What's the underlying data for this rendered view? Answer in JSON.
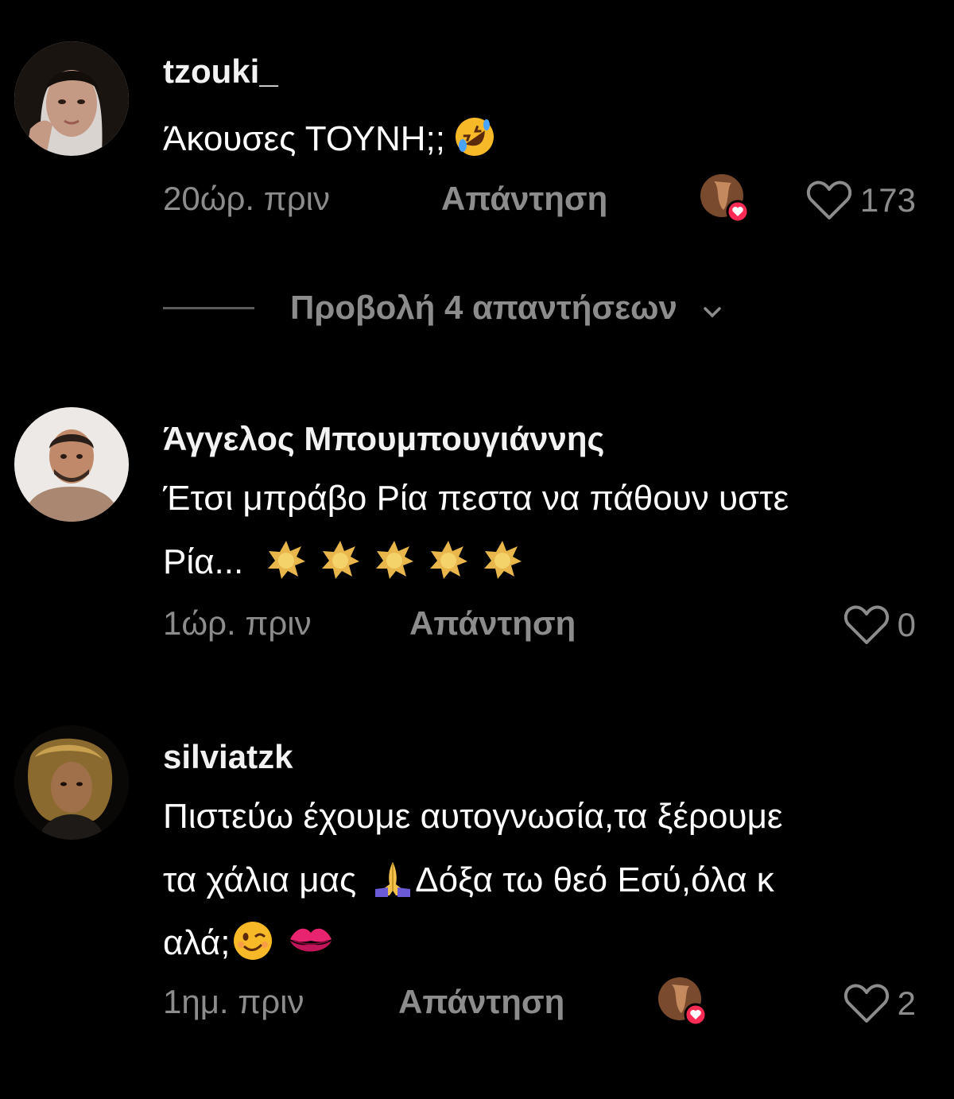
{
  "comments": [
    {
      "username": "tzouki_",
      "text_lines": [
        "Άκουσες ΤΟΥΝΗ;;"
      ],
      "emojis": [
        "rolling-on-floor-laughing"
      ],
      "time": "20ώρ. πριν",
      "reply_label": "Απάντηση",
      "creator_liked": true,
      "likes": "173"
    },
    {
      "username": "Άγγελος Μπουμπουγιάννης",
      "text_lines": [
        "Έτσι μπράβο Ρία πεστα να πάθουν υστε",
        "Ρία..."
      ],
      "emojis": [
        "star-burst",
        "star-burst",
        "star-burst",
        "star-burst",
        "star-burst"
      ],
      "time": "1ώρ. πριν",
      "reply_label": "Απάντηση",
      "creator_liked": false,
      "likes": "0"
    },
    {
      "username": "silviatzk",
      "text_lines": [
        "Πιστεύω έχουμε αυτογνωσία,τα ξέρουμε",
        "τα χάλια μας",
        "Δόξα τω θεό Εσύ,όλα κ",
        "αλά;"
      ],
      "emojis": [
        "folded-hands",
        "winking-face",
        "kiss-mark"
      ],
      "time": "1ημ. πριν",
      "reply_label": "Απάντηση",
      "creator_liked": true,
      "likes": "2"
    }
  ],
  "view_replies": {
    "label": "Προβολή 4 απαντήσεων"
  },
  "colors": {
    "background": "#000000",
    "text": "#ffffff",
    "muted": "#8c8c8c",
    "like_badge": "#fe2c55"
  }
}
